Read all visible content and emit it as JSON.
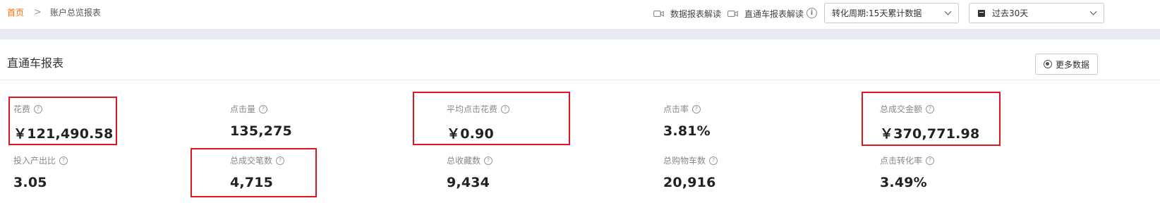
{
  "breadcrumb": {
    "home": "首页",
    "separator": ">",
    "current": "账户总览报表"
  },
  "toolbar": {
    "data_report_guide": "数据报表解读",
    "ztc_report_guide": "直通车报表解读",
    "info_icon": "i",
    "conversion_period": "转化周期:15天累计数据",
    "date_range": "过去30天"
  },
  "section": {
    "title": "直通车报表",
    "more_button": "更多数据"
  },
  "metrics": [
    {
      "label": "花费",
      "value": "￥121,490.58"
    },
    {
      "label": "点击量",
      "value": "135,275"
    },
    {
      "label": "平均点击花费",
      "value": "￥0.90"
    },
    {
      "label": "点击率",
      "value": "3.81%"
    },
    {
      "label": "总成交金额",
      "value": "￥370,771.98"
    },
    {
      "label": "投入产出比",
      "value": "3.05"
    },
    {
      "label": "总成交笔数",
      "value": "4,715"
    },
    {
      "label": "总收藏数",
      "value": "9,434"
    },
    {
      "label": "总购物车数",
      "value": "20,916"
    },
    {
      "label": "点击转化率",
      "value": "3.49%"
    }
  ],
  "help_icon": "?",
  "colors": {
    "accent": "#ff6a00",
    "highlight": "#e0151f",
    "band": "#e8ebf3"
  },
  "icons": [
    "video-camera-icon",
    "info-icon",
    "chevron-down-icon",
    "calendar-icon",
    "gear-icon",
    "help-icon"
  ]
}
